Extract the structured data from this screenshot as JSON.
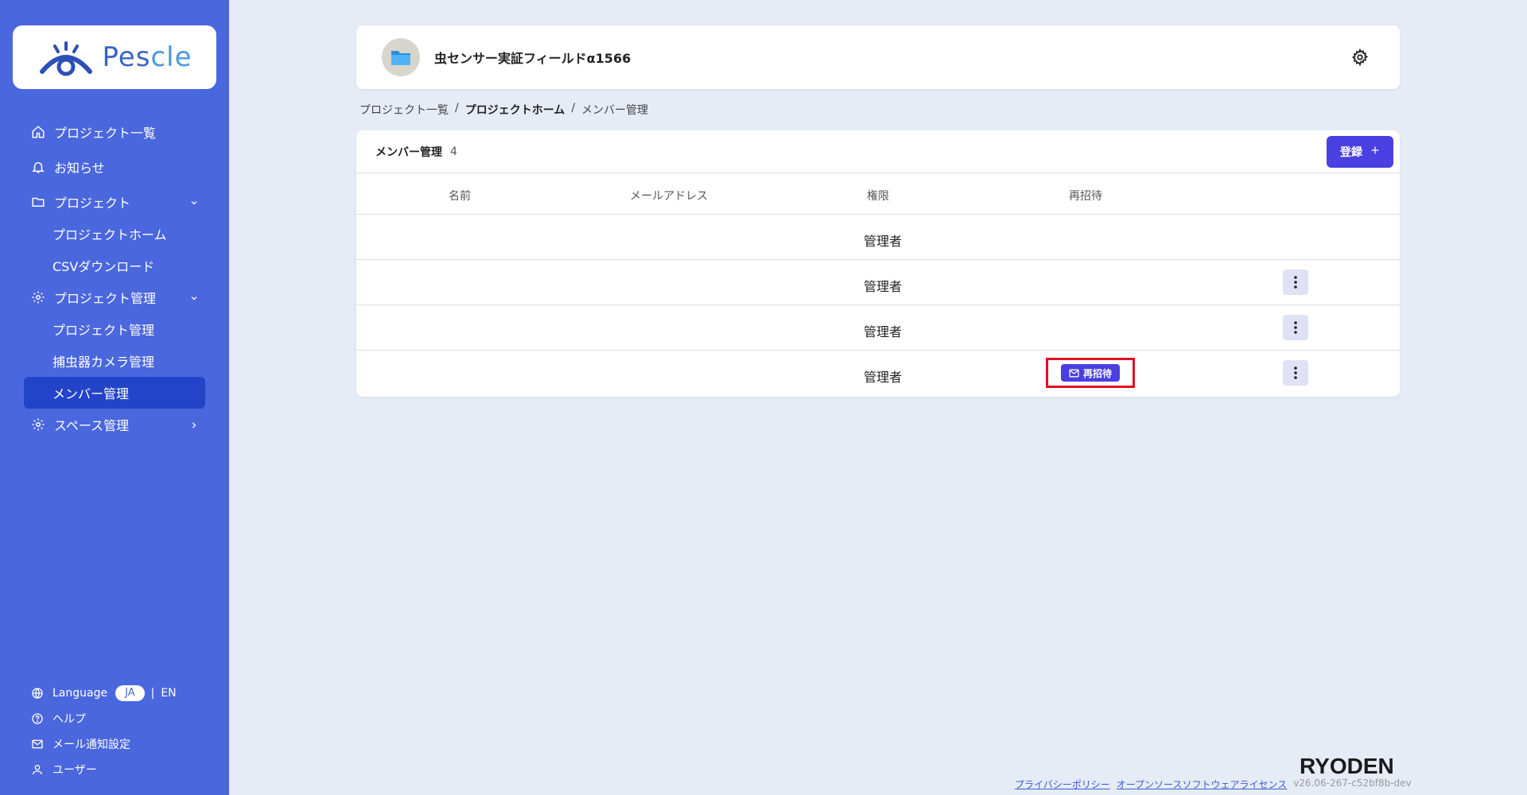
{
  "brand": {
    "logo_text_a": "Pes",
    "logo_text_b": "cle",
    "company": "RYODEN"
  },
  "sidebar": {
    "items": [
      {
        "label": "プロジェクト一覧",
        "icon": "home-icon"
      },
      {
        "label": "お知らせ",
        "icon": "bell-icon"
      },
      {
        "label": "プロジェクト",
        "icon": "folder-icon",
        "expanded": true
      },
      {
        "label": "プロジェクトホーム"
      },
      {
        "label": "CSVダウンロード"
      },
      {
        "label": "プロジェクト管理",
        "icon": "gear-icon",
        "expanded": true
      },
      {
        "label": "プロジェクト管理"
      },
      {
        "label": "捕虫器カメラ管理"
      },
      {
        "label": "メンバー管理",
        "active": true
      },
      {
        "label": "スペース管理",
        "icon": "gear-icon"
      }
    ],
    "footer": {
      "language_label": "Language",
      "lang_selected": "JA",
      "lang_other": "EN",
      "help": "ヘルプ",
      "mail_settings": "メール通知設定",
      "user": "ユーザー"
    }
  },
  "header": {
    "project_title": "虫センサー実証フィールドα1566"
  },
  "breadcrumb": {
    "first": "プロジェクト一覧",
    "sep": "/",
    "second": "プロジェクトホーム",
    "third": "メンバー管理"
  },
  "members": {
    "title": "メンバー管理",
    "count": "4",
    "register_label": "登録",
    "columns": {
      "name": "名前",
      "email": "メールアドレス",
      "role": "権限",
      "reinvite": "再招待"
    },
    "rows": [
      {
        "role": "管理者",
        "has_menu": false,
        "reinvite": false
      },
      {
        "role": "管理者",
        "has_menu": true,
        "reinvite": false
      },
      {
        "role": "管理者",
        "has_menu": true,
        "reinvite": false
      },
      {
        "role": "管理者",
        "has_menu": true,
        "reinvite": true
      }
    ],
    "reinvite_button": "再招待"
  },
  "footer": {
    "privacy": "プライバシーポリシー",
    "oss": "オープンソースソフトウェアライセンス",
    "version": "v26.06-267-c52bf8b-dev"
  },
  "colors": {
    "sidebar": "#4a67de",
    "accent": "#4a3fe0",
    "highlight": "#e01020"
  }
}
